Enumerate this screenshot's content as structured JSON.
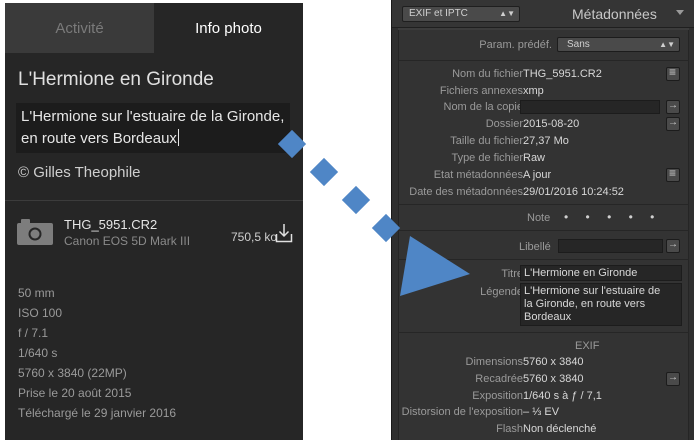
{
  "left_panel": {
    "tabs": {
      "activity": "Activité",
      "info": "Info photo"
    },
    "title": "L'Hermione en Gironde",
    "caption_lines": [
      "L'Hermione sur l'estuaire de la Gironde,",
      "en route vers Bordeaux"
    ],
    "copyright": "© Gilles Theophile",
    "file": {
      "name": "THG_5951.CR2",
      "camera": "Canon EOS 5D Mark III",
      "size": "750,5 ko"
    },
    "specs": [
      "50 mm",
      "ISO 100",
      "f / 7.1",
      "1/640 s",
      "5760 x 3840 (22MP)",
      "Prise le 20 août 2015",
      "Téléchargé le 29 janvier 2016"
    ]
  },
  "right_panel": {
    "preset_select": "EXIF et IPTC",
    "title": "Métadonnées",
    "param_label": "Param. prédéf.",
    "param_value": "Sans",
    "rows": [
      {
        "label": "Nom du fichier",
        "value": "THG_5951.CR2"
      },
      {
        "label": "Fichiers annexes",
        "value": "xmp"
      },
      {
        "label": "Nom de la copie",
        "value": ""
      },
      {
        "label": "Dossier",
        "value": "2015-08-20"
      },
      {
        "label": "Taille du fichier",
        "value": "27,37 Mo"
      },
      {
        "label": "Type de fichier",
        "value": "Raw"
      },
      {
        "label": "Etat métadonnées",
        "value": "A jour"
      },
      {
        "label": "Date des métadonnées",
        "value": "29/01/2016 10:24:52"
      }
    ],
    "note_label": "Note",
    "note_dots": "• • • • •",
    "libelle_label": "Libellé",
    "titre_label": "Titre",
    "titre_value": "L'Hermione en Gironde",
    "legende_label": "Légende",
    "legende_lines": [
      "L'Hermione sur l'estuaire de",
      "la Gironde, en route vers",
      "Bordeaux"
    ],
    "exif_heading": "EXIF",
    "exif_rows": [
      {
        "label": "Dimensions",
        "value": "5760 x 3840"
      },
      {
        "label": "Recadrée",
        "value": "5760 x 3840"
      },
      {
        "label": "Exposition",
        "value": "1/640 s à ƒ / 7,1"
      },
      {
        "label": "Distorsion de l'exposition",
        "value": "– ⅓ EV"
      },
      {
        "label": "Flash",
        "value": "Non déclenché"
      }
    ]
  },
  "colors": {
    "arrow": "#4f86c6",
    "left_bg": "#262626",
    "right_bg": "#2f2f2f"
  },
  "icons": [
    "camera-icon",
    "download-icon",
    "updown-icon",
    "triangle-icon",
    "arrow-right-icon",
    "list-icon"
  ]
}
